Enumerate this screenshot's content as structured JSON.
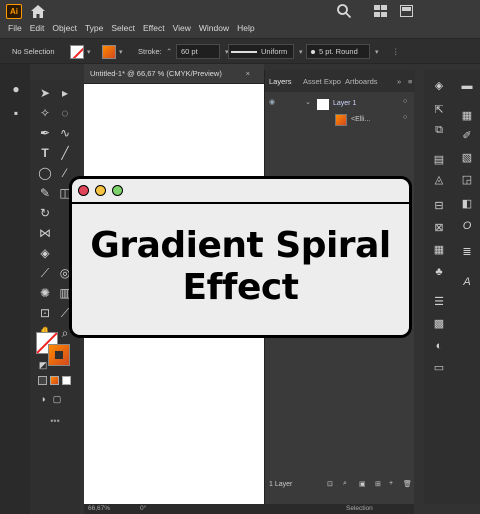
{
  "app": {
    "logo": "Ai",
    "menu": [
      "File",
      "Edit",
      "Object",
      "Type",
      "Select",
      "Effect",
      "View",
      "Window",
      "Help"
    ]
  },
  "control_bar": {
    "selection_label": "No Selection",
    "stroke_label": "Stroke:",
    "stroke_value": "60 pt",
    "profile_label": "Uniform",
    "brush_label": "5 pt. Round"
  },
  "document": {
    "tab_title": "Untitled-1* @ 66,67 % (CMYK/Preview)",
    "zoom_status": "66,67%",
    "rotation_status": "0°",
    "tool_status": "Selection"
  },
  "layers_panel": {
    "tabs": [
      "Layers",
      "Asset Expo",
      "Artboards"
    ],
    "layer_name": "Layer 1",
    "sublayer_name": "<Elli...",
    "footer_count": "1 Layer"
  },
  "overlay": {
    "title_line1": "Gradient Spiral",
    "title_line2": "Effect",
    "dot_colors": [
      "#e0455a",
      "#f6c244",
      "#7dd26b"
    ]
  },
  "colors": {
    "accent": "#ff9a00",
    "gradient_start": "#ff8a00",
    "gradient_end": "#d2491f"
  }
}
